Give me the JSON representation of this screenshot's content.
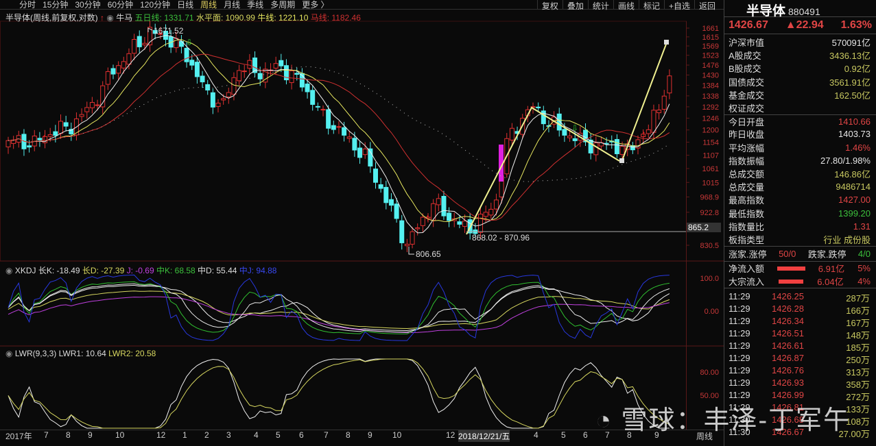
{
  "toolbar": {
    "tabs": [
      "分时",
      "15分钟",
      "30分钟",
      "60分钟",
      "120分钟",
      "日线",
      "周线",
      "月线",
      "季线",
      "多周期",
      "更多 〉"
    ],
    "active": "周线",
    "right": [
      "复权",
      "叠加",
      "统计",
      "画线",
      "标记",
      "+自选",
      "返回"
    ]
  },
  "info": {
    "title": "半导体(周线,前复权,对数)",
    "niuma": "牛马",
    "ma5": "五日线: 1331.71",
    "flat": "水平面: 1090.99",
    "bull": "牛线: 1221.10",
    "horse": "马线: 1182.46"
  },
  "header": {
    "name": "半导体",
    "code": "880491",
    "price": "1426.67",
    "change": "▲22.94",
    "pct": "1.63%"
  },
  "stats": [
    {
      "label": "沪深市值",
      "value": "570091亿",
      "c": "w"
    },
    {
      "label": "A股成交",
      "value": "3436.13亿",
      "c": "y"
    },
    {
      "label": "B股成交",
      "value": "0.92亿",
      "c": "y"
    },
    {
      "label": "国债成交",
      "value": "3561.91亿",
      "c": "y"
    },
    {
      "label": "基金成交",
      "value": "162.50亿",
      "c": "y"
    },
    {
      "label": "权证成交",
      "value": "",
      "c": "w"
    },
    {
      "label": "今日开盘",
      "value": "1410.66",
      "c": "r"
    },
    {
      "label": "昨日收盘",
      "value": "1403.73",
      "c": "w"
    },
    {
      "label": "平均涨幅",
      "value": "1.46%",
      "c": "r"
    },
    {
      "label": "指数振幅",
      "value": "27.80/1.98%",
      "c": "w"
    },
    {
      "label": "总成交额",
      "value": "146.86亿",
      "c": "y"
    },
    {
      "label": "总成交量",
      "value": "9486714",
      "c": "y"
    },
    {
      "label": "最高指数",
      "value": "1427.00",
      "c": "r"
    },
    {
      "label": "最低指数",
      "value": "1399.20",
      "c": "g"
    },
    {
      "label": "指数量比",
      "value": "1.31",
      "c": "r"
    },
    {
      "label": "板指类型",
      "value": "行业 成份股",
      "c": "y"
    }
  ],
  "breadth": {
    "up_label": "涨家.涨停",
    "up": "50/0",
    "down_label": "跌家.跌停",
    "down": "4/0"
  },
  "flows": [
    {
      "label": "净流入额",
      "value": "6.91亿",
      "pct": "5%",
      "bar": 0.9
    },
    {
      "label": "大宗流入",
      "value": "6.04亿",
      "pct": "4%",
      "bar": 0.8
    }
  ],
  "ticks": [
    [
      "11:29",
      "1426.25",
      "287万"
    ],
    [
      "11:29",
      "1426.28",
      "166万"
    ],
    [
      "11:29",
      "1426.34",
      "167万"
    ],
    [
      "11:29",
      "1426.51",
      "148万"
    ],
    [
      "11:29",
      "1426.61",
      "185万"
    ],
    [
      "11:29",
      "1426.87",
      "250万"
    ],
    [
      "11:29",
      "1426.76",
      "313万"
    ],
    [
      "11:29",
      "1426.93",
      "358万"
    ],
    [
      "11:29",
      "1426.99",
      "272万"
    ],
    [
      "11:29",
      "1426.81",
      "133万"
    ],
    [
      "11:30",
      "1426.68",
      "108万"
    ],
    [
      "11:30",
      "1426.67",
      "27.00万"
    ]
  ],
  "xkdj": {
    "name": "XKDJ",
    "longK": "长K: -18.49",
    "longD": "长D: -27.39",
    "J": "J: -0.69",
    "midK": "中K: 68.58",
    "midD": "中D: 55.44",
    "extra": "中J: 94.88",
    "axis": [
      "100.0",
      "0.00"
    ]
  },
  "lwr": {
    "name": "LWR(9,3,3)",
    "lwr1": "LWR1: 10.64",
    "lwr2": "LWR2: 20.58",
    "axis": [
      "80.00",
      "50.00"
    ]
  },
  "annotations": {
    "high": "1671.52",
    "low": "806.65",
    "range": "868.02 - 870.96",
    "hline": "865.2"
  },
  "xaxis": {
    "labels": [
      "2017年",
      "7",
      "8",
      "9",
      "10",
      "12",
      "1",
      "2",
      "3",
      "4",
      "5",
      "6",
      "7",
      "8",
      "9",
      "10",
      "12",
      "2018/12/21/五",
      "4",
      "5",
      "6",
      "7",
      "8",
      "9"
    ],
    "period": "周线"
  },
  "watermark": "雪球：丰泽-丁军午",
  "chart_data": {
    "type": "candlestick",
    "scale": "log",
    "yticks": [
      "1661",
      "1615",
      "1569",
      "1523",
      "1476",
      "1430",
      "1384",
      "1338",
      "1292",
      "1246",
      "1200",
      "1154",
      "1107",
      "1061",
      "1015",
      "968.9",
      "922.8",
      "830.5"
    ],
    "price_keypoints": [
      [
        0,
        1160
      ],
      [
        5,
        1150
      ],
      [
        8,
        1190
      ],
      [
        12,
        1215
      ],
      [
        16,
        1300
      ],
      [
        20,
        1450
      ],
      [
        24,
        1560
      ],
      [
        27,
        1640
      ],
      [
        31,
        1600
      ],
      [
        34,
        1520
      ],
      [
        38,
        1340
      ],
      [
        41,
        1300
      ],
      [
        44,
        1470
      ],
      [
        48,
        1440
      ],
      [
        52,
        1470
      ],
      [
        56,
        1390
      ],
      [
        60,
        1250
      ],
      [
        64,
        1180
      ],
      [
        68,
        1100
      ],
      [
        72,
        960
      ],
      [
        76,
        830
      ],
      [
        78,
        880
      ],
      [
        81,
        950
      ],
      [
        84,
        910
      ],
      [
        88,
        870
      ],
      [
        91,
        915
      ],
      [
        93,
        960
      ],
      [
        95,
        1150
      ],
      [
        98,
        1250
      ],
      [
        100,
        1290
      ],
      [
        103,
        1230
      ],
      [
        106,
        1190
      ],
      [
        109,
        1160
      ],
      [
        112,
        1140
      ],
      [
        115,
        1150
      ],
      [
        118,
        1120
      ],
      [
        120,
        1170
      ],
      [
        122,
        1200
      ],
      [
        124,
        1300
      ],
      [
        126,
        1426
      ]
    ],
    "colors": {
      "up": "#e03030",
      "down": "#54f0f0",
      "ma5": "#f0f0f0",
      "ma10": "#e8e860",
      "ma20": "#d03030"
    }
  }
}
